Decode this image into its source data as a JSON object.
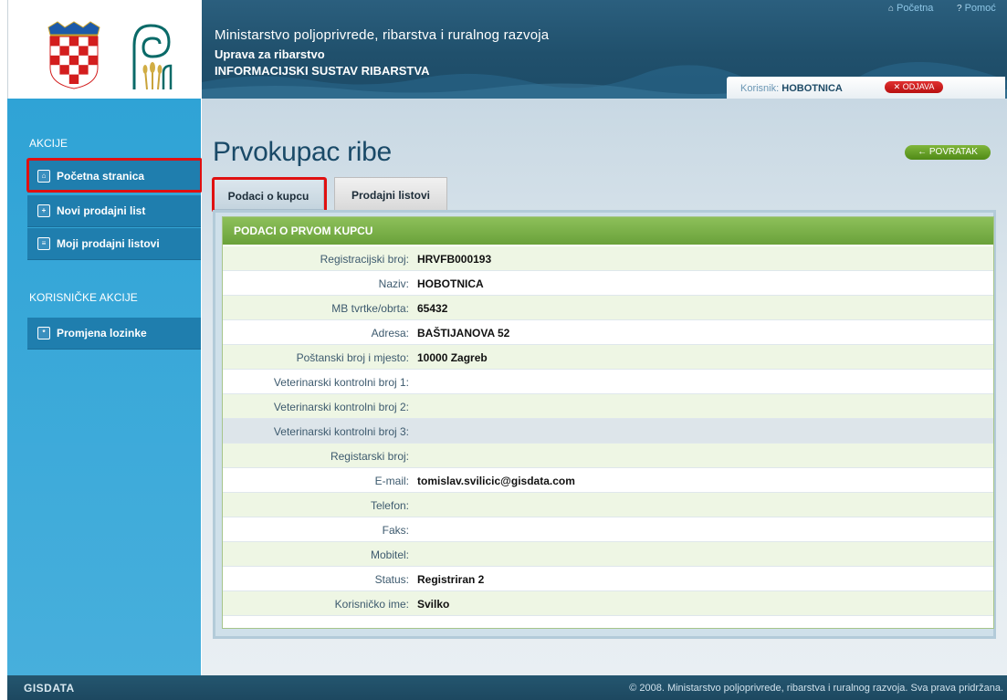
{
  "header": {
    "ministry": "Ministarstvo poljoprivrede, ribarstva i ruralnog razvoja",
    "department": "Uprava za ribarstvo",
    "system_name": "INFORMACIJSKI SUSTAV RIBARSTVA",
    "home_link": "Početna",
    "help_link": "Pomoć",
    "user_label": "Korisnik:",
    "user_name": "HOBOTNICA",
    "logout_label": "ODJAVA"
  },
  "sidebar": {
    "section_actions": "AKCIJE",
    "items": [
      {
        "label": "Početna stranica",
        "icon": "home-icon"
      },
      {
        "label": "Novi prodajni list",
        "icon": "add-document-icon"
      },
      {
        "label": "Moji prodajni listovi",
        "icon": "documents-icon"
      }
    ],
    "section_user": "KORISNIČKE AKCIJE",
    "user_items": [
      {
        "label": "Promjena lozinke",
        "icon": "password-icon"
      }
    ]
  },
  "main": {
    "title": "Prvokupac ribe",
    "back_label": "POVRATAK",
    "tabs": [
      {
        "label": "Podaci o kupcu",
        "active": true
      },
      {
        "label": "Prodajni listovi",
        "active": false
      }
    ],
    "panel_title": "PODACI O PRVOM KUPCU",
    "fields": [
      {
        "label": "Registracijski broj:",
        "value": "HRVFB000193"
      },
      {
        "label": "Naziv:",
        "value": "HOBOTNICA"
      },
      {
        "label": "MB tvrtke/obrta:",
        "value": "65432"
      },
      {
        "label": "Adresa:",
        "value": "BAŠTIJANOVA 52"
      },
      {
        "label": "Poštanski broj i mjesto:",
        "value": "10000 Zagreb"
      },
      {
        "label": "Veterinarski kontrolni broj 1:",
        "value": ""
      },
      {
        "label": "Veterinarski kontrolni broj 2:",
        "value": ""
      },
      {
        "label": "Veterinarski kontrolni broj 3:",
        "value": ""
      },
      {
        "label": "Registarski broj:",
        "value": ""
      },
      {
        "label": "E-mail:",
        "value": "tomislav.svilicic@gisdata.com"
      },
      {
        "label": "Telefon:",
        "value": ""
      },
      {
        "label": "Faks:",
        "value": ""
      },
      {
        "label": "Mobitel:",
        "value": ""
      },
      {
        "label": "Status:",
        "value": "Registriran 2"
      },
      {
        "label": "Korisničko ime:",
        "value": "Svilko"
      }
    ]
  },
  "footer": {
    "brand": "GISDATA",
    "copyright": "© 2008. Ministarstvo poljoprivrede, ribarstva i ruralnog razvoja. Sva prava pridržana."
  },
  "colors": {
    "banner": "#20506c",
    "sidebar": "#2fa3d6",
    "panel_header": "#78ad45",
    "highlight": "#e01010",
    "logout": "#c81818",
    "back_button": "#5f9a22"
  }
}
